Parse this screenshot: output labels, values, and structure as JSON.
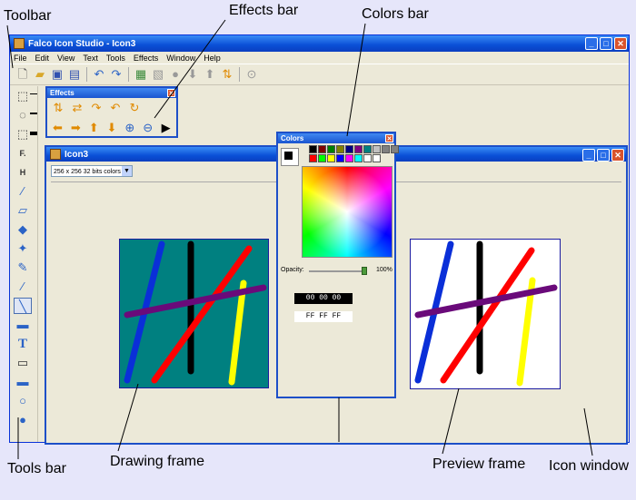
{
  "annotations": {
    "toolbar": "Toolbar",
    "effects_bar": "Effects bar",
    "colors_bar": "Colors bar",
    "tools_bar": "Tools bar",
    "drawing_frame": "Drawing frame",
    "preview_frame": "Preview frame",
    "icon_window": "Icon window"
  },
  "app": {
    "title": "Falco Icon Studio - Icon3",
    "menu": [
      "File",
      "Edit",
      "View",
      "Text",
      "Tools",
      "Effects",
      "Window",
      "Help"
    ],
    "toolbar_icons": [
      "new-file-icon",
      "open-folder-icon",
      "save-icon",
      "save-as-icon",
      "undo-icon",
      "redo-icon",
      "add-frame-icon",
      "delete-frame-icon",
      "circle-icon",
      "move-down-icon",
      "move-up-icon",
      "sort-icon",
      "settings-icon"
    ]
  },
  "tools": [
    "rect-select",
    "ellipse-select",
    "lasso-select",
    "text-fx",
    "image-fx",
    "eyedropper",
    "eraser",
    "fill-bucket",
    "spray",
    "pencil",
    "brush",
    "line",
    "gradient",
    "text",
    "rectangle-outline",
    "rectangle-filled",
    "ellipse-outline",
    "ellipse-filled"
  ],
  "effects": {
    "title": "Effects",
    "row1": [
      "flip-vertical-icon",
      "flip-horizontal-icon",
      "rotate-90-cw-icon",
      "rotate-90-ccw-icon",
      "rotate-180-icon"
    ],
    "row2": [
      "shift-left-icon",
      "shift-right-icon",
      "shift-up-icon",
      "shift-down-icon",
      "zoom-in-icon",
      "zoom-out-icon",
      "play-icon"
    ]
  },
  "icon_window": {
    "title": "Icon3",
    "size_option": "256 x 256 32 bits colors",
    "drawing_bg": "#008080",
    "preview_bg": "#ffffff",
    "strokes": [
      {
        "name": "blue-stroke",
        "color": "#0a2fd8"
      },
      {
        "name": "black-stroke",
        "color": "#000000"
      },
      {
        "name": "red-stroke",
        "color": "#ff0000"
      },
      {
        "name": "yellow-stroke",
        "color": "#ffff00"
      },
      {
        "name": "purple-stroke",
        "color": "#6a0a7a"
      }
    ]
  },
  "colors": {
    "title": "Colors",
    "palette": [
      "#000000",
      "#800000",
      "#008000",
      "#808000",
      "#000080",
      "#800080",
      "#008080",
      "#c0c0c0",
      "#808080",
      "#808080",
      "#ff0000",
      "#00ff00",
      "#ffff00",
      "#0000ff",
      "#ff00ff",
      "#00ffff",
      "#ffffff",
      "#ffffff"
    ],
    "opacity_label": "Opacity:",
    "opacity_value": "100%",
    "opacity_fraction": 1.0,
    "fg_hex": "00 00 00",
    "bg_hex": "FF FF FF"
  }
}
